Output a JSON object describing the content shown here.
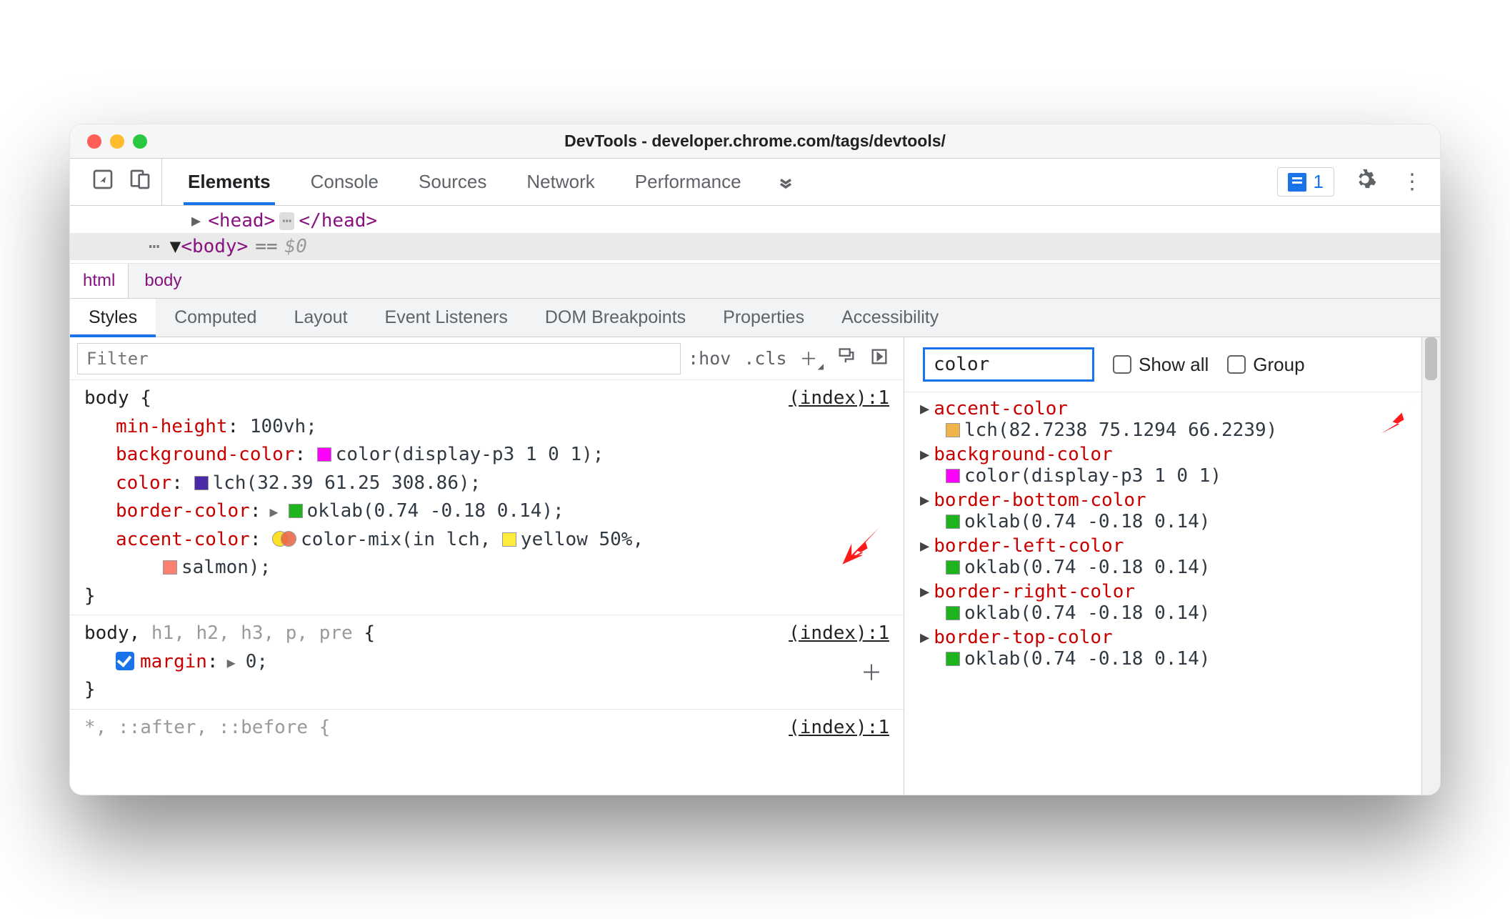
{
  "title": "DevTools - developer.chrome.com/tags/devtools/",
  "mainTabs": [
    "Elements",
    "Console",
    "Sources",
    "Network",
    "Performance"
  ],
  "issuesCount": "1",
  "domHead": {
    "open": "<head>",
    "close": "</head>"
  },
  "domBody": {
    "tag": "<body>",
    "eq": "==",
    "dollar": "$0"
  },
  "breadcrumb": [
    "html",
    "body"
  ],
  "styleTabs": [
    "Styles",
    "Computed",
    "Layout",
    "Event Listeners",
    "DOM Breakpoints",
    "Properties",
    "Accessibility"
  ],
  "filterPlaceholder": "Filter",
  "filterActions": {
    "hov": ":hov",
    "cls": ".cls"
  },
  "rule1": {
    "selector": "body {",
    "source": "(index):1",
    "p1": {
      "name": "min-height",
      "val": "100vh;"
    },
    "p2": {
      "name": "background-color",
      "val": "color(display-p3 1 0 1);",
      "swatch": "#ff00ff"
    },
    "p3": {
      "name": "color",
      "val": "lch(32.39 61.25 308.86);",
      "swatch": "#4a2aa6"
    },
    "p4": {
      "name": "border-color",
      "val": "oklab(0.74 -0.18 0.14);",
      "swatch": "#1db41e"
    },
    "p5": {
      "name": "accent-color",
      "v1": "color-mix(in lch, ",
      "mixSw": "#ffeb3b",
      "v2": "yellow 50%,",
      "salmonSw": "#fa8072",
      "v3": "salmon);"
    },
    "close": "}"
  },
  "rule2": {
    "selectorA": "body,",
    "selectorB": " h1, h2, h3, p, pre ",
    "brace": "{",
    "source": "(index):1",
    "p": {
      "name": "margin",
      "val": "0;"
    },
    "close": "}"
  },
  "rule3": {
    "selector": "*, ::after, ::before {",
    "source": "(index):1"
  },
  "rightFilterValue": "color",
  "rightShowAll": "Show all",
  "rightGroup": "Group",
  "computed": [
    {
      "name": "accent-color",
      "val": "lch(82.7238 75.1294 66.2239)",
      "sw": "#f0b34a"
    },
    {
      "name": "background-color",
      "val": "color(display-p3 1 0 1)",
      "sw": "#ff00ff"
    },
    {
      "name": "border-bottom-color",
      "val": "oklab(0.74 -0.18 0.14)",
      "sw": "#1db41e"
    },
    {
      "name": "border-left-color",
      "val": "oklab(0.74 -0.18 0.14)",
      "sw": "#1db41e"
    },
    {
      "name": "border-right-color",
      "val": "oklab(0.74 -0.18 0.14)",
      "sw": "#1db41e"
    },
    {
      "name": "border-top-color",
      "val": "oklab(0.74 -0.18 0.14)",
      "sw": "#1db41e"
    }
  ]
}
